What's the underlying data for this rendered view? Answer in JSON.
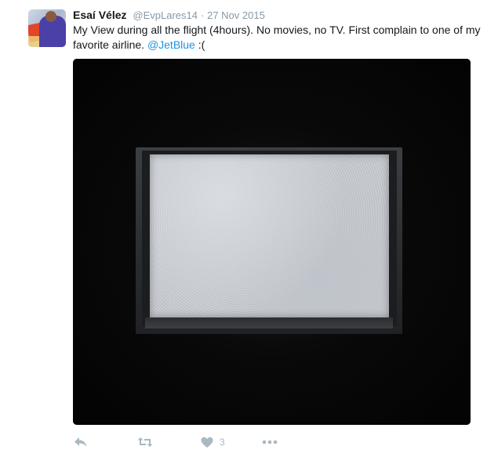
{
  "tweet": {
    "author_name": "Esaí Vélez",
    "author_handle": "@EvpLares14",
    "separator": "·",
    "date": "27 Nov 2015",
    "text_part1": "My View during all the flight (4hours). No movies, no TV. First complain to one of my favorite airline. ",
    "mention": "@JetBlue",
    "text_part2": " :("
  },
  "actions": {
    "reply_icon": "reply-icon",
    "retweet_icon": "retweet-icon",
    "like_icon": "heart-icon",
    "like_count": "3",
    "more_icon": "more-icon"
  },
  "colors": {
    "link": "#1b95e0",
    "muted": "#8899a6",
    "action": "#aab8c2"
  }
}
